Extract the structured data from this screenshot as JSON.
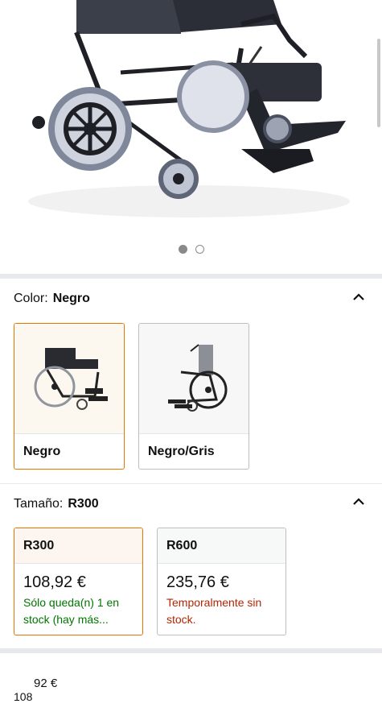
{
  "gallery": {
    "page_count": 2,
    "active_index": 0
  },
  "color_section": {
    "label": "Color:",
    "selected": "Negro",
    "options": [
      {
        "label": "Negro",
        "selected": true
      },
      {
        "label": "Negro/Gris",
        "selected": false
      }
    ]
  },
  "size_section": {
    "label": "Tamaño:",
    "selected": "R300",
    "options": [
      {
        "name": "R300",
        "price": "108,92 €",
        "availability": "Sólo queda(n) 1 en stock (hay más...",
        "selected": true
      },
      {
        "name": "R600",
        "price": "235,76 €",
        "availability": "Temporalmente sin stock.",
        "selected": false
      }
    ]
  },
  "bottom": {
    "price_cents": "92 €",
    "price_whole": "108"
  },
  "colors": {
    "accent": "#e77600",
    "in_stock": "#007600",
    "out_of_stock": "#b12704"
  }
}
